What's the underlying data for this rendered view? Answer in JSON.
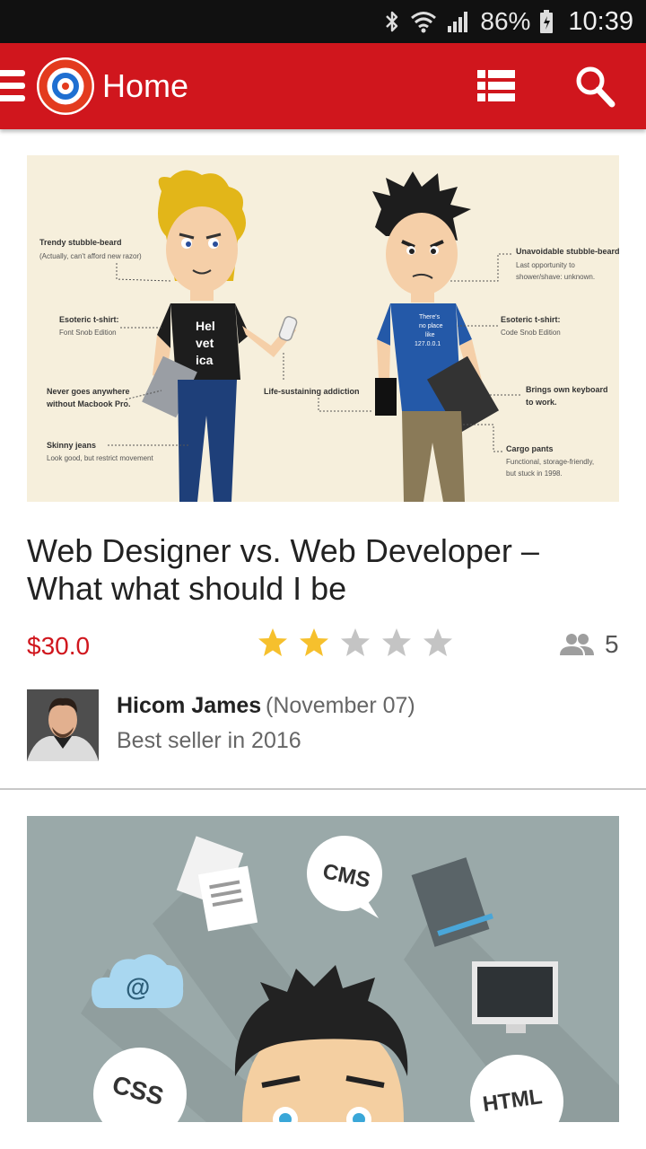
{
  "status_bar": {
    "battery": "86%",
    "time": "10:39"
  },
  "app_bar": {
    "title": "Home",
    "colors": {
      "background": "#d0161d",
      "logo_blue": "#1f6fd1"
    }
  },
  "cards": [
    {
      "title": " Web Designer vs. Web Developer – What what should I be",
      "price": "$30.0",
      "rating": 2,
      "rating_max": 5,
      "members": "5",
      "author": {
        "name": "Hicom James",
        "date": "(November 07)",
        "subtitle": "Best seller in 2016"
      },
      "illustration": {
        "designer_shirt": "Hel vet ica",
        "developer_shirt": "There's no place like 127.0.0.1",
        "labels": {
          "beard": "Trendy stubble-beard",
          "beard_note": "(Actually, can't afford new razor)",
          "tshirt": "Esoteric t-shirt:",
          "tshirt_note": "Font Snob Edition",
          "macbook": "Never goes anywhere without Macbook Pro.",
          "jeans": "Skinny jeans",
          "jeans_note": "Look good, but restrict movement",
          "addiction": "Life-sustaining addiction",
          "dev_beard": "Unavoidable stubble-beard",
          "dev_beard_note": "Last opportunity to shower/shave: unknown.",
          "dev_tshirt": "Esoteric t-shirt:",
          "dev_tshirt_note": "Code Snob Edition",
          "keyboard": "Brings own keyboard to work.",
          "cargo": "Cargo pants",
          "cargo_note": "Functional, storage-friendly, but stuck in 1998."
        }
      }
    },
    {
      "illustration": {
        "bubbles": [
          "CMS",
          "@",
          "CSS",
          "HTML"
        ]
      }
    }
  ],
  "colors": {
    "accent": "#d0161d",
    "star_on": "#f6c02d",
    "star_off": "#c4c4c4"
  },
  "icons": [
    "bluetooth-icon",
    "wifi-icon",
    "signal-icon",
    "battery-icon",
    "menu-icon",
    "app-logo",
    "list-view-icon",
    "search-icon",
    "star-icon",
    "members-icon"
  ]
}
